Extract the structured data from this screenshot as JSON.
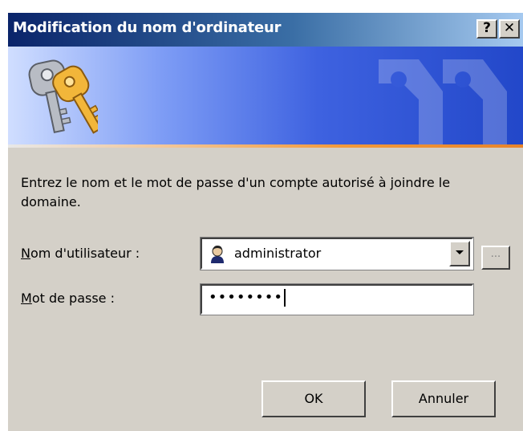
{
  "window": {
    "title": "Modification du nom d'ordinateur",
    "help_label": "?",
    "close_label": "✕"
  },
  "banner": {
    "icon": "keys-icon",
    "watermark": "keys-watermark",
    "accent_color": "#f39a3a"
  },
  "form": {
    "description": "Entrez le nom et le mot de passe d'un compte autorisé à joindre le domaine.",
    "username_label_mnemonic": "N",
    "username_label_rest": "om d'utilisateur :",
    "username_value": "administrator",
    "browse_label": "...",
    "password_label_mnemonic": "M",
    "password_label_rest": "ot de passe :",
    "password_masked": "••••••••"
  },
  "buttons": {
    "ok_label": "OK",
    "cancel_label": "Annuler"
  }
}
